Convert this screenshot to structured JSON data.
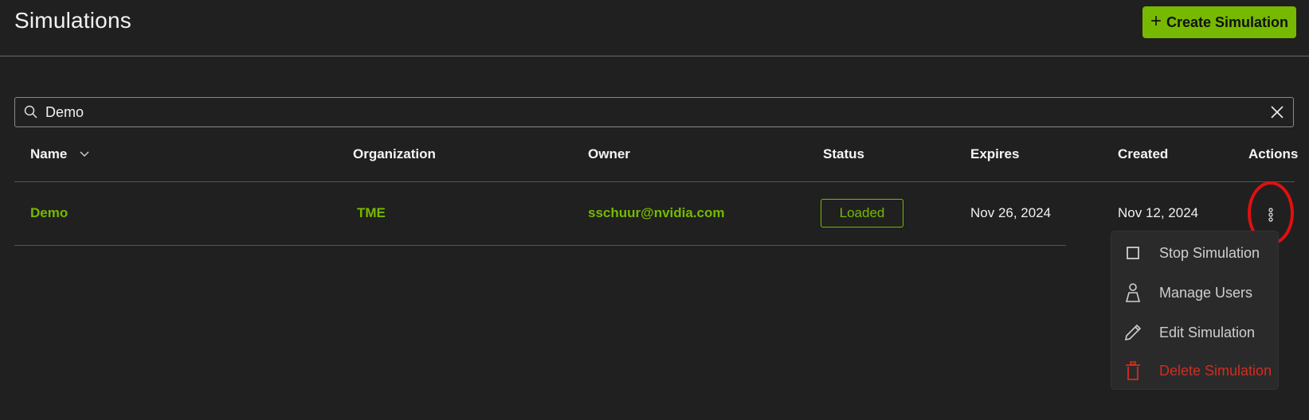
{
  "header": {
    "title": "Simulations",
    "create_button_label": "Create Simulation",
    "create_button_icon": "plus-icon"
  },
  "search": {
    "value": "Demo",
    "icon": "search-icon",
    "clear_icon": "close-icon"
  },
  "table": {
    "columns": [
      {
        "label": "Name",
        "sort": "descending"
      },
      {
        "label": "Organization"
      },
      {
        "label": "Owner"
      },
      {
        "label": "Status"
      },
      {
        "label": "Expires"
      },
      {
        "label": "Created"
      },
      {
        "label": "Actions"
      }
    ],
    "rows": [
      {
        "name": "Demo",
        "organization": "TME",
        "owner": "sschuur@nvidia.com",
        "status": "Loaded",
        "expires": "Nov 26, 2024",
        "created": "Nov 12, 2024"
      }
    ]
  },
  "actions_menu": {
    "items": [
      {
        "label": "Stop Simulation",
        "icon": "stop-icon"
      },
      {
        "label": "Manage Users",
        "icon": "user-icon"
      },
      {
        "label": "Edit Simulation",
        "icon": "pencil-icon"
      },
      {
        "label": "Delete Simulation",
        "icon": "trash-icon",
        "danger": true
      }
    ]
  },
  "colors": {
    "accent": "#76b900",
    "background": "#202020",
    "danger": "#d22c21",
    "annotation": "#e01010"
  }
}
